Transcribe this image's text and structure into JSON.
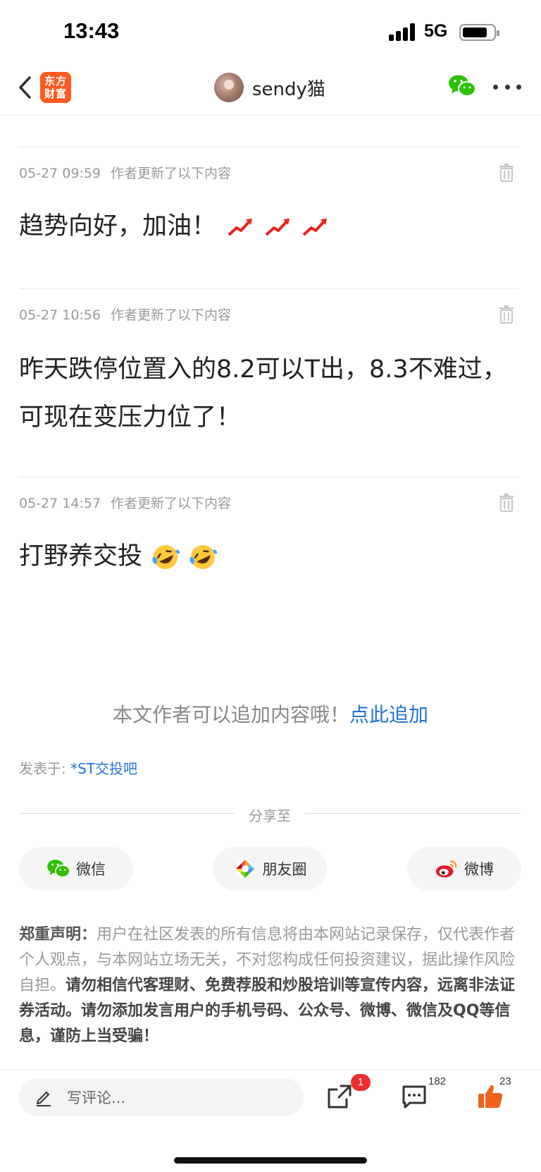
{
  "status_bar": {
    "time": "13:43",
    "network": "5G",
    "battery_level": 0.75
  },
  "nav": {
    "logo_line1": "东方",
    "logo_line2": "财富",
    "username": "sendy猫"
  },
  "updates": [
    {
      "date": "05-27 09:59",
      "note": "作者更新了以下内容",
      "text": "趋势向好，加油！",
      "emoji": "chart-increasing-sparkle x3"
    },
    {
      "date": "05-27 10:56",
      "note": "作者更新了以下内容",
      "text": "昨天跌停位置入的8.2可以T出，8.3不难过，可现在变压力位了！"
    },
    {
      "date": "05-27 14:57",
      "note": "作者更新了以下内容",
      "text": "打野养交投",
      "emoji": "rolling-on-floor-laughing x2"
    }
  ],
  "append": {
    "prompt": "本文作者可以追加内容哦！",
    "link": "点此追加"
  },
  "posted_in": {
    "label": "发表于: ",
    "bar": "*ST交投吧"
  },
  "share": {
    "label": "分享至",
    "wechat": "微信",
    "moments": "朋友圈",
    "weibo": "微博"
  },
  "disclaimer": {
    "head": "郑重声明：",
    "body": "用户在社区发表的所有信息将由本网站记录保存，仅代表作者个人观点，与本网站立场无关，不对您构成任何投资建议，据此操作风险自担。",
    "strong": "请勿相信代客理财、免费荐股和炒股培训等宣传内容，远离非法证券活动。请勿添加发言用户的手机号码、公众号、微博、微信及QQ等信息，谨防上当受骗！"
  },
  "bottom": {
    "comment_placeholder": "写评论...",
    "share_badge": "1",
    "comment_count": "182",
    "like_count": "23"
  },
  "colors": {
    "brand_orange": "#ff5a1f",
    "link_blue": "#1f74d6",
    "badge_red": "#f02d2d",
    "like_orange": "#f0631c",
    "wechat_green": "#2dc100"
  }
}
